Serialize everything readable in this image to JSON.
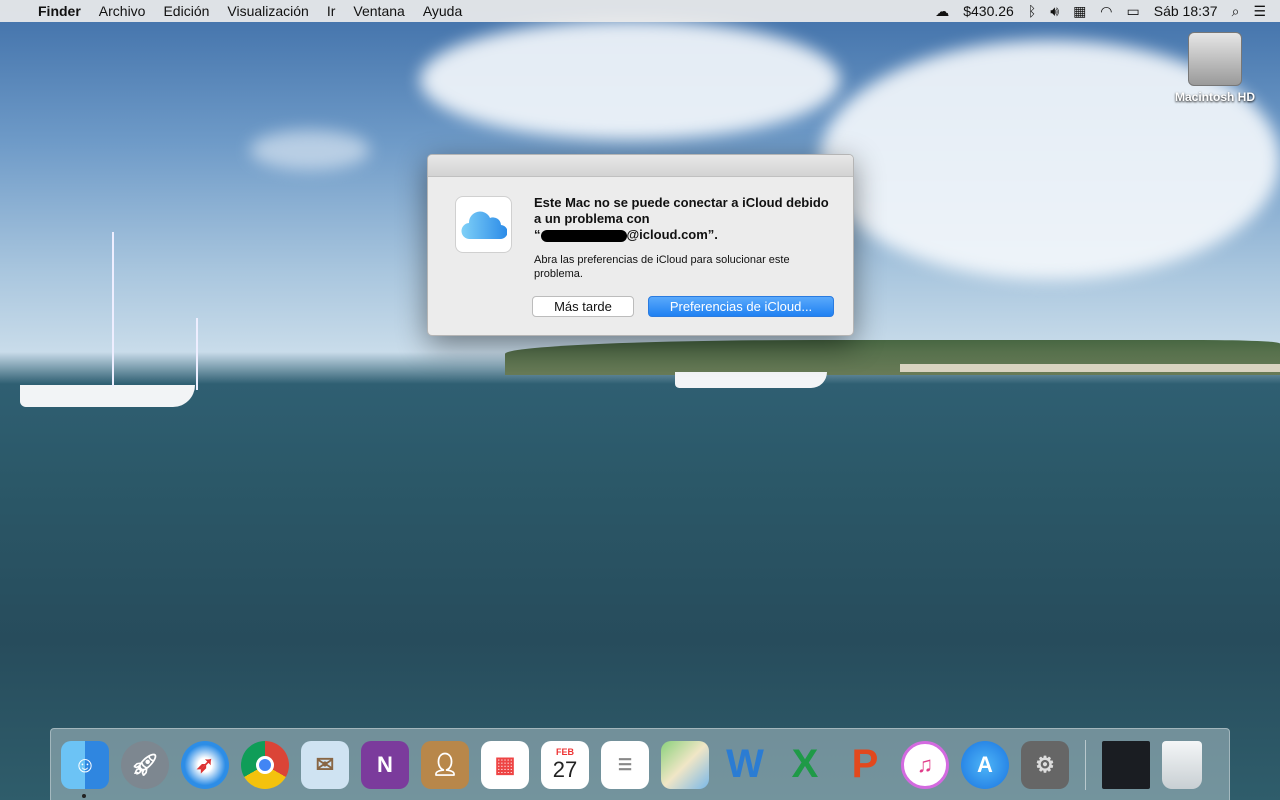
{
  "menubar": {
    "apple": "",
    "app": "Finder",
    "items": [
      "Archivo",
      "Edición",
      "Visualización",
      "Ir",
      "Ventana",
      "Ayuda"
    ],
    "stock": "$430.26",
    "clock": "Sáb 18:37"
  },
  "desktop": {
    "drive_label": "Macintosh HD"
  },
  "dialog": {
    "title_line": "Este Mac no se puede conectar a iCloud debido a un problema con",
    "email_open": "“",
    "email_suffix": "@icloud.com”.",
    "info": "Abra las preferencias de iCloud para solucionar este problema.",
    "later_button": "Más tarde",
    "prefs_button": "Preferencias de iCloud..."
  },
  "dock": {
    "calendar_month": "FEB",
    "calendar_day": "27",
    "apps": [
      "Finder",
      "Launchpad",
      "Safari",
      "Chrome",
      "Mail",
      "OneNote",
      "Contacts",
      "Launchpad grid",
      "Calendar",
      "Reminders",
      "Maps",
      "Word",
      "Excel",
      "PowerPoint",
      "iTunes",
      "App Store",
      "System Preferences",
      "Desktop stack",
      "Trash"
    ],
    "letters": {
      "onenote": "N",
      "word": "W",
      "excel": "X",
      "powerpoint": "P"
    }
  }
}
